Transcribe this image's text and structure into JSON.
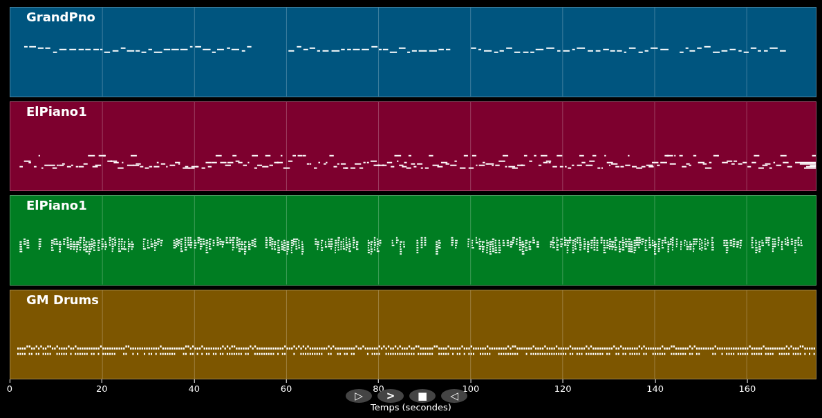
{
  "tracks": [
    {
      "name": "GrandPno",
      "kind": "melody",
      "color": "#00557f"
    },
    {
      "name": "ElPiano1",
      "kind": "scattered",
      "color": "#7d002e"
    },
    {
      "name": "ElPiano1",
      "kind": "chords",
      "color": "#007d22"
    },
    {
      "name": "GM Drums",
      "kind": "drums",
      "color": "#7d5600"
    }
  ],
  "x_axis": {
    "ticks": [
      "0",
      "20",
      "40",
      "60",
      "80",
      "100",
      "120",
      "140",
      "160"
    ],
    "label": "Temps (secondes)"
  },
  "controls": [
    "▷",
    ">",
    "■",
    "◁"
  ]
}
